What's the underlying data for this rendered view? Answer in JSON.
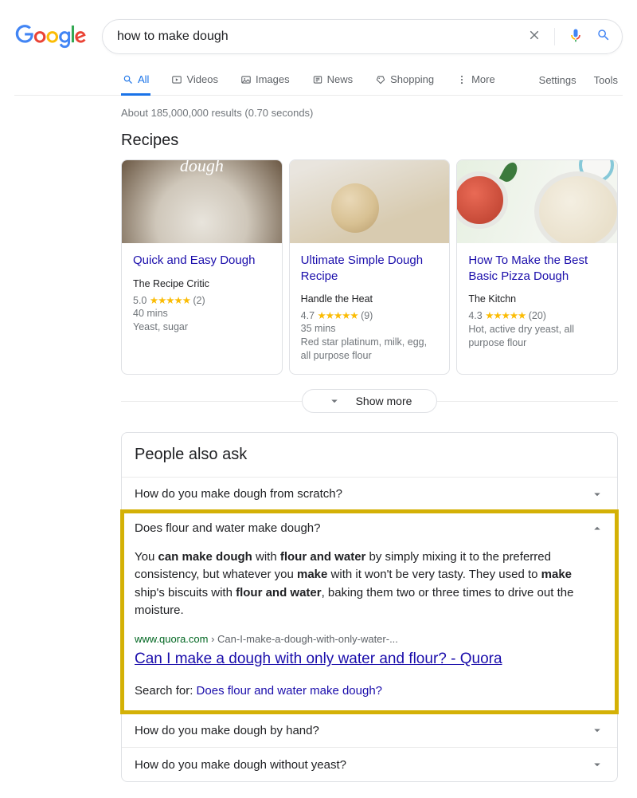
{
  "search": {
    "query": "how to make dough",
    "placeholder": ""
  },
  "tabs": {
    "all": "All",
    "videos": "Videos",
    "images": "Images",
    "news": "News",
    "shopping": "Shopping",
    "more": "More"
  },
  "right_links": {
    "settings": "Settings",
    "tools": "Tools"
  },
  "stats": "About 185,000,000 results (0.70 seconds)",
  "recipes": {
    "heading": "Recipes",
    "show_more": "Show more",
    "items": [
      {
        "title": "Quick and Easy Dough",
        "source": "The Recipe Critic",
        "rating": "5.0",
        "stars": "★★★★★",
        "rcount": "(2)",
        "time": "40 mins",
        "ingredients": "Yeast, sugar"
      },
      {
        "title": "Ultimate Simple Dough Recipe",
        "source": "Handle the Heat",
        "rating": "4.7",
        "stars": "★★★★★",
        "rcount": "(9)",
        "time": "35 mins",
        "ingredients": "Red star platinum, milk, egg, all purpose flour"
      },
      {
        "title": "How To Make the Best Basic Pizza Dough",
        "source": "The Kitchn",
        "rating": "4.3",
        "stars": "★★★★★",
        "rcount": "(20)",
        "time": "",
        "ingredients": "Hot, active dry yeast, all purpose flour"
      }
    ]
  },
  "paa": {
    "heading": "People also ask",
    "q0": "How do you make dough from scratch?",
    "q1": "Does flour and water make dough?",
    "q2": "How do you make dough by hand?",
    "q3": "How do you make dough without yeast?",
    "answer": {
      "p1a": "You ",
      "p1b": "can make dough",
      "p1c": " with ",
      "p1d": "flour and water",
      "p1e": " by simply mixing it to the preferred consistency, but whatever you ",
      "p1f": "make",
      "p1g": " with it won't be very tasty. They used to ",
      "p1h": "make",
      "p1i": " ship's biscuits with ",
      "p1j": "flour and water",
      "p1k": ", baking them two or three times to drive out the moisture.",
      "cite_domain": "www.quora.com",
      "cite_separator": " › ",
      "cite_path": "Can-I-make-a-dough-with-only-water-...",
      "link_title": "Can I make a dough with only water and flour? - Quora",
      "search_for_label": "Search for: ",
      "search_for_link": "Does flour and water make dough?"
    }
  }
}
